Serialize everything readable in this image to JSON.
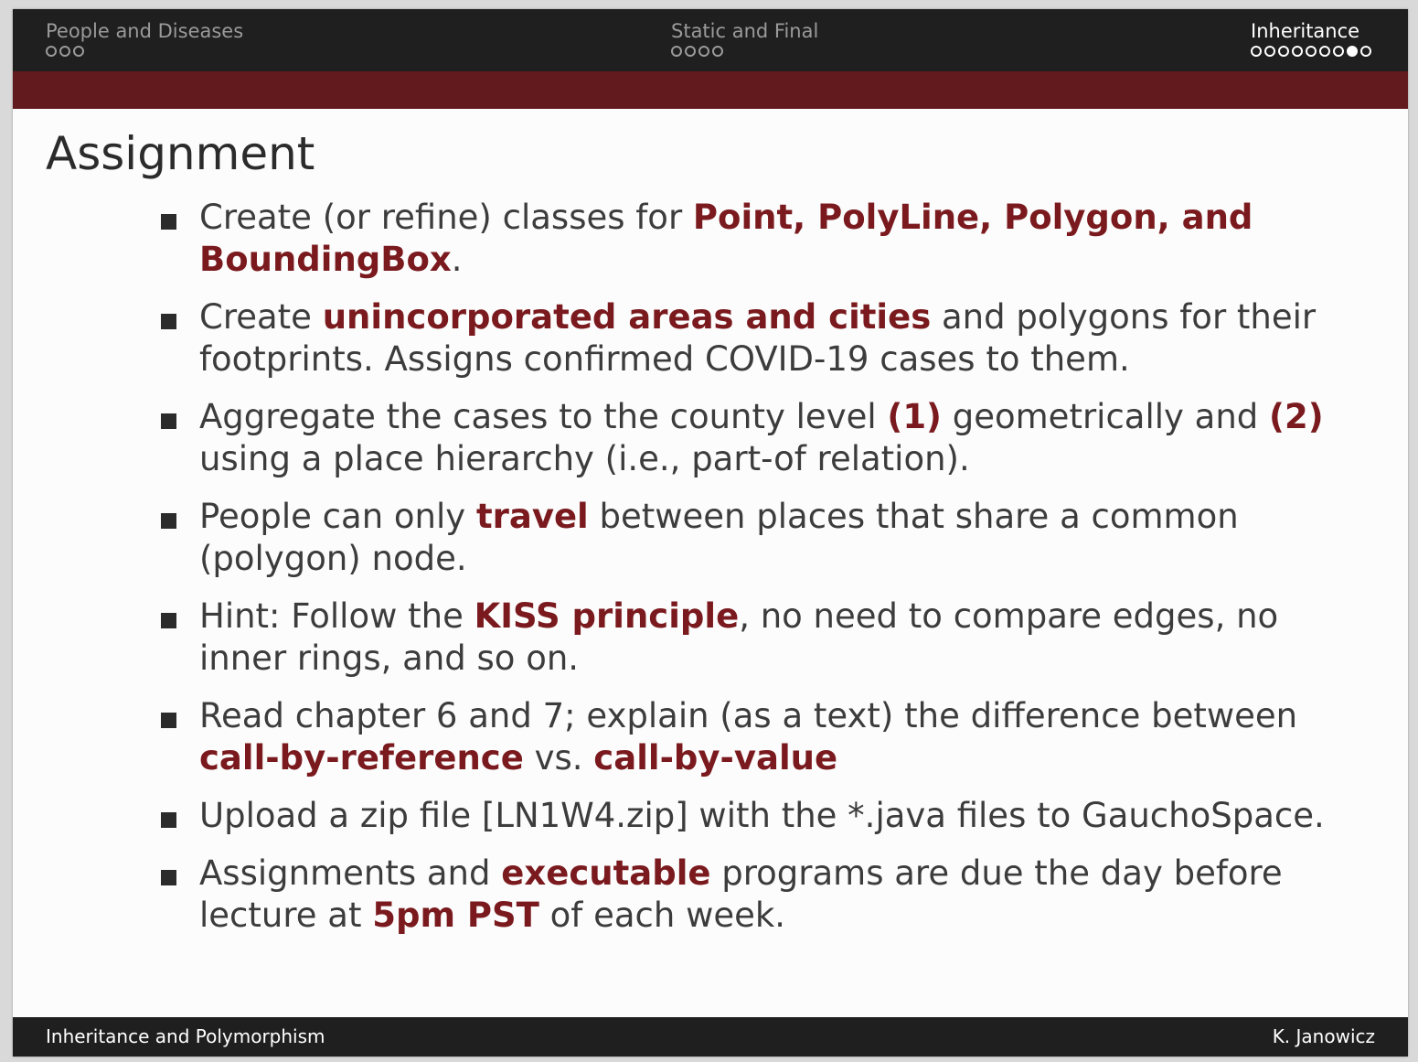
{
  "nav": {
    "sections": [
      {
        "name": "People and Diseases",
        "dots": 3,
        "filled_index": -1
      },
      {
        "name": "Static and Final",
        "dots": 4,
        "filled_index": -1
      },
      {
        "name": "Inheritance",
        "dots": 9,
        "filled_index": 7
      }
    ]
  },
  "slide": {
    "title": "Assignment",
    "bullets": [
      [
        {
          "text": "Create (or refine) classes for "
        },
        {
          "text": "Point, PolyLine, Polygon, and BoundingBox",
          "hl": true
        },
        {
          "text": "."
        }
      ],
      [
        {
          "text": "Create "
        },
        {
          "text": "unincorporated areas and cities",
          "hl": true
        },
        {
          "text": " and polygons for their footprints. Assigns confirmed COVID-19 cases to them."
        }
      ],
      [
        {
          "text": "Aggregate the cases to the county level "
        },
        {
          "text": "(1)",
          "hl": true
        },
        {
          "text": " geometrically and "
        },
        {
          "text": "(2)",
          "hl": true
        },
        {
          "text": " using a place hierarchy (i.e., part-of relation)."
        }
      ],
      [
        {
          "text": "People can only "
        },
        {
          "text": "travel",
          "hl": true
        },
        {
          "text": " between places that share a common (polygon) node."
        }
      ],
      [
        {
          "text": "Hint: Follow the "
        },
        {
          "text": "KISS principle",
          "hl": true
        },
        {
          "text": ", no need to compare edges, no inner rings, and so on."
        }
      ],
      [
        {
          "text": "Read chapter 6 and 7; explain (as a text) the difference between "
        },
        {
          "text": "call-by-reference",
          "hl": true
        },
        {
          "text": " vs. "
        },
        {
          "text": "call-by-value",
          "hl": true
        }
      ],
      [
        {
          "text": "Upload a zip file [LN1W4.zip] with the *.java files to GauchoSpace."
        }
      ],
      [
        {
          "text": "Assignments and "
        },
        {
          "text": "executable",
          "hl": true
        },
        {
          "text": " programs are due the day before lecture at "
        },
        {
          "text": "5pm PST",
          "hl": true
        },
        {
          "text": " of each week."
        }
      ]
    ]
  },
  "footer": {
    "left": "Inheritance and Polymorphism",
    "right": "K. Janowicz"
  },
  "colors": {
    "accent": "#7a1a1e",
    "band": "#631a1e",
    "bar": "#1f1f1f"
  }
}
